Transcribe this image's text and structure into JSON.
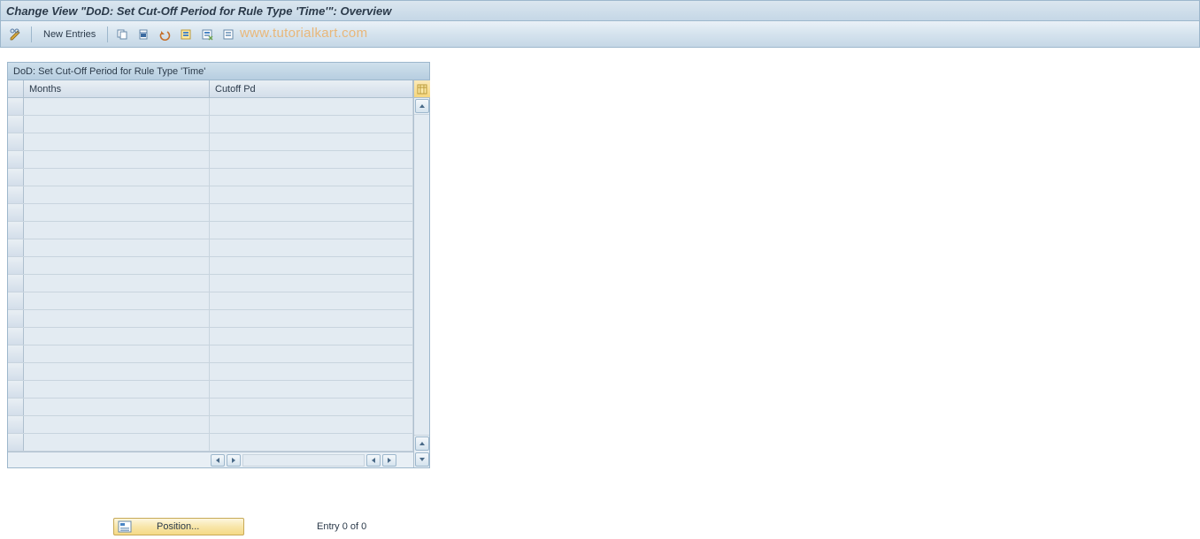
{
  "title": "Change View \"DoD: Set Cut-Off Period for Rule Type 'Time'\": Overview",
  "toolbar": {
    "new_entries_label": "New Entries",
    "icons": {
      "toggle": "toggle-icon",
      "copy": "copy-icon",
      "delete": "delete-icon",
      "undo": "undo-icon",
      "select_all": "select-all-icon",
      "deselect_all": "deselect-block-icon",
      "deselect": "deselect-icon"
    }
  },
  "watermark": "www.tutorialkart.com",
  "panel": {
    "title": "DoD: Set Cut-Off Period for Rule Type 'Time'",
    "columns": {
      "months": "Months",
      "cutoff": "Cutoff Pd"
    },
    "row_count": 20
  },
  "footer": {
    "position_label": "Position...",
    "entry_text": "Entry 0 of 0"
  }
}
